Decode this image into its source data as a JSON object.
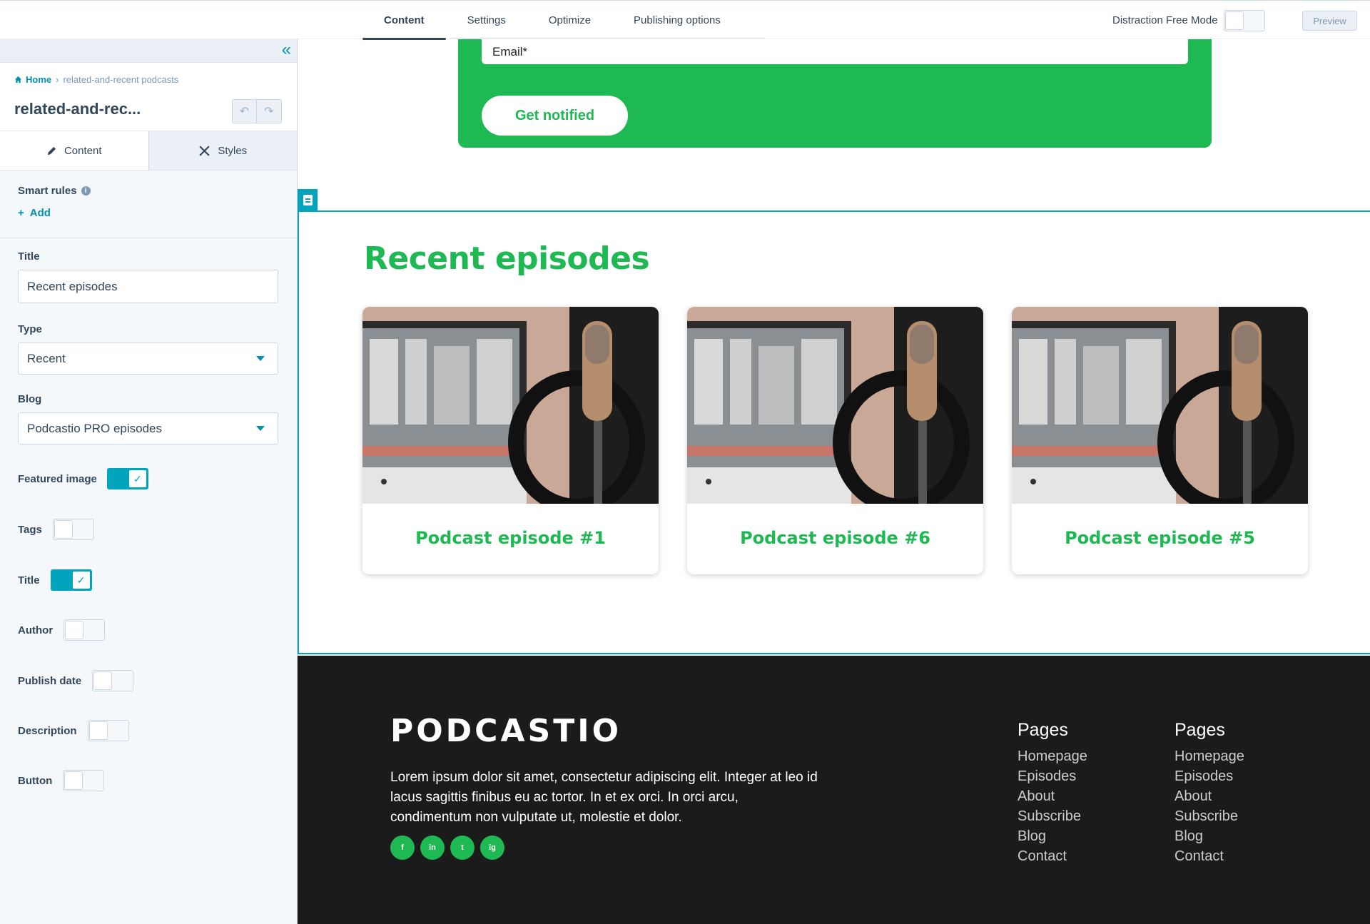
{
  "topbar": {
    "tabs": [
      "Content",
      "Settings",
      "Optimize",
      "Publishing options"
    ],
    "distraction_free_label": "Distraction Free Mode",
    "preview_label": "Preview"
  },
  "sidebar": {
    "breadcrumb": {
      "home": "Home",
      "current": "related-and-recent podcasts"
    },
    "module_title": "related-and-rec...",
    "tabs": {
      "content": "Content",
      "styles": "Styles"
    },
    "smart_rules": {
      "label": "Smart rules",
      "add": "Add"
    },
    "fields": {
      "title_label": "Title",
      "title_value": "Recent episodes",
      "type_label": "Type",
      "type_value": "Recent",
      "blog_label": "Blog",
      "blog_value": "Podcastio PRO episodes"
    },
    "toggles": {
      "featured_image": {
        "label": "Featured image",
        "on": true
      },
      "tags": {
        "label": "Tags",
        "on": false
      },
      "title": {
        "label": "Title",
        "on": true
      },
      "author": {
        "label": "Author",
        "on": false
      },
      "publish_date": {
        "label": "Publish date",
        "on": false
      },
      "description": {
        "label": "Description",
        "on": false
      },
      "button": {
        "label": "Button",
        "on": false
      }
    }
  },
  "canvas": {
    "signup": {
      "email_placeholder": "Email*",
      "button": "Get notified"
    },
    "recent": {
      "heading": "Recent episodes",
      "episodes": [
        "Podcast episode #1",
        "Podcast episode #6",
        "Podcast episode #5"
      ]
    },
    "footer": {
      "logo": "PODCASTIO",
      "text": "Lorem ipsum dolor sit amet, consectetur adipiscing elit. Integer at leo id lacus sagittis finibus eu ac tortor. In et ex orci. In orci arcu, condimentum non vulputate ut, molestie et dolor.",
      "socials": [
        "f",
        "in",
        "t",
        "ig"
      ],
      "columns": [
        {
          "heading": "Pages",
          "links": [
            "Homepage",
            "Episodes",
            "About",
            "Subscribe",
            "Blog",
            "Contact"
          ]
        },
        {
          "heading": "Pages",
          "links": [
            "Homepage",
            "Episodes",
            "About",
            "Subscribe",
            "Blog",
            "Contact"
          ]
        }
      ]
    }
  },
  "colors": {
    "accent": "#00a4bd",
    "brand_green": "#1fb953",
    "link": "#0091ae",
    "footer_bg": "#1b1b1b"
  }
}
